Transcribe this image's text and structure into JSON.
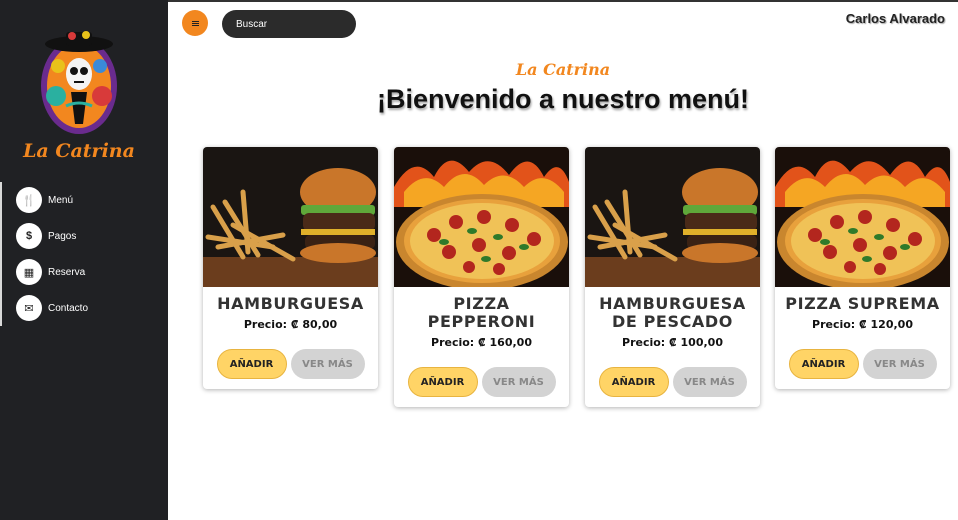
{
  "brand": {
    "name": "La Catrina"
  },
  "sidebar": {
    "items": [
      {
        "label": "Menú",
        "icon": "fork-knife-icon",
        "glyph": "🍴"
      },
      {
        "label": "Pagos",
        "icon": "dollar-icon",
        "glyph": "$"
      },
      {
        "label": "Reserva",
        "icon": "calendar-icon",
        "glyph": "▦"
      },
      {
        "label": "Contacto",
        "icon": "envelope-icon",
        "glyph": "✉"
      }
    ]
  },
  "header": {
    "search_placeholder": "Buscar",
    "user_name": "Carlos Alvarado"
  },
  "hero": {
    "brand_small": "La Catrina",
    "title": "¡Bienvenido a nuestro menú!"
  },
  "products": [
    {
      "title": "HAMBURGUESA",
      "price": "Precio: ₡ 80,00",
      "image": "burger-fries",
      "add_label": "AÑADIR",
      "more_label": "VER MÁS"
    },
    {
      "title": "PIZZA PEPPERONI",
      "price": "Precio: ₡ 160,00",
      "image": "pizza",
      "add_label": "AÑADIR",
      "more_label": "VER MÁS"
    },
    {
      "title": "HAMBURGUESA DE PESCADO",
      "price": "Precio: ₡ 100,00",
      "image": "burger-fries",
      "add_label": "AÑADIR",
      "more_label": "VER MÁS"
    },
    {
      "title": "PIZZA SUPREMA",
      "price": "Precio: ₡ 120,00",
      "image": "pizza",
      "add_label": "AÑADIR",
      "more_label": "VER MÁS"
    }
  ],
  "colors": {
    "accent": "#f2871f",
    "sidebar": "#202124",
    "add_button": "#ffd466",
    "more_button": "#d3d3d3"
  }
}
